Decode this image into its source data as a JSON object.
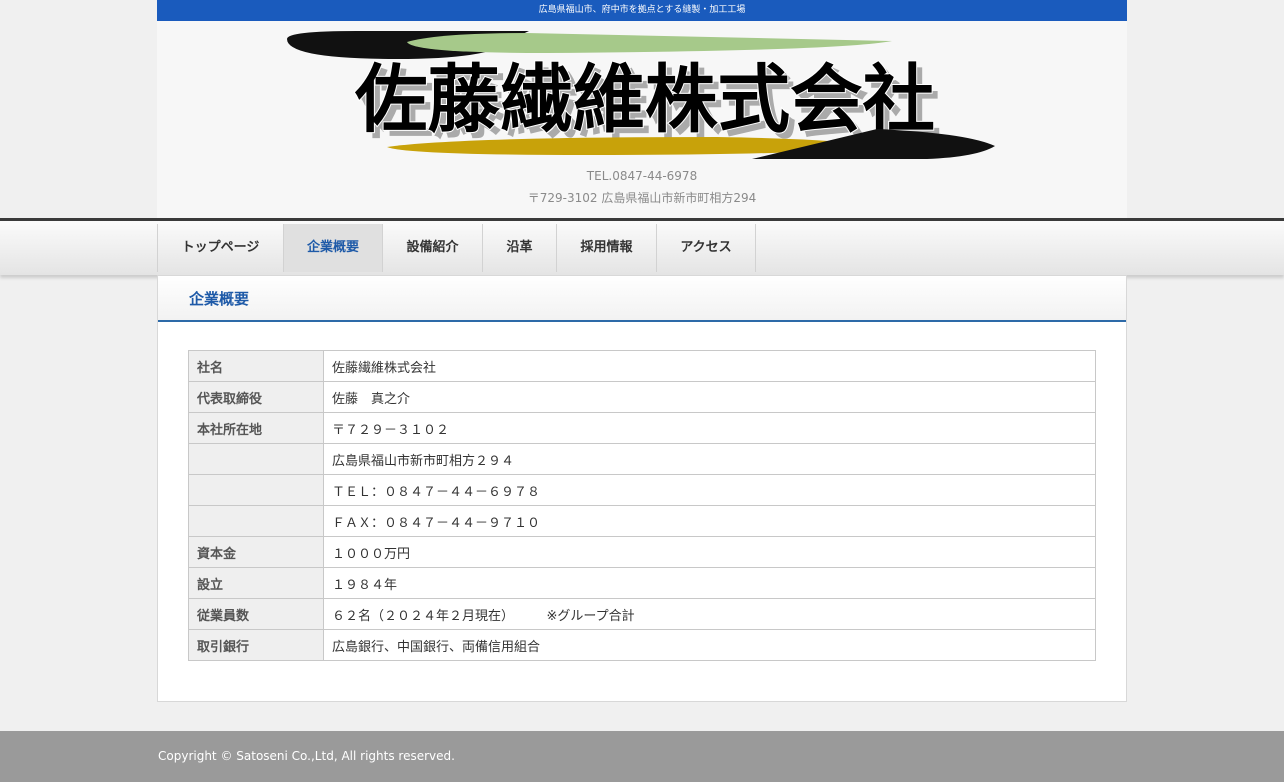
{
  "header": {
    "tagline": "広島県福山市、府中市を拠点とする縫製・加工工場",
    "logo_text": "佐藤繊維株式会社",
    "tel": "TEL.0847-44-6978",
    "address": "〒729-3102 広島県福山市新市町相方294"
  },
  "nav": {
    "items": [
      {
        "label": "トップページ"
      },
      {
        "label": "企業概要"
      },
      {
        "label": "設備紹介"
      },
      {
        "label": "沿革"
      },
      {
        "label": "採用情報"
      },
      {
        "label": "アクセス"
      }
    ],
    "active": "企業概要"
  },
  "main": {
    "title": "企業概要",
    "rows": [
      {
        "label": "社名",
        "value": "佐藤繊維株式会社"
      },
      {
        "label": "代表取締役",
        "value": "佐藤　真之介"
      },
      {
        "label": "本社所在地",
        "value": "〒７２９－３１０２"
      },
      {
        "label": "",
        "value": "広島県福山市新市町相方２９４"
      },
      {
        "label": "",
        "value": "ＴＥＬ：０８４７－４４－６９７８"
      },
      {
        "label": "",
        "value": "ＦＡＸ：０８４７－４４－９７１０"
      },
      {
        "label": "資本金",
        "value": "１０００万円"
      },
      {
        "label": "設立",
        "value": "１９８４年"
      },
      {
        "label": "従業員数",
        "value": "６２名（２０２４年２月現在）　　　※グループ合計"
      },
      {
        "label": "取引銀行",
        "value": "広島銀行、中国銀行、両備信用組合"
      }
    ]
  },
  "footer": {
    "copyright": "Copyright © Satoseni Co.,Ltd, All rights reserved."
  },
  "colors": {
    "topbar": "#1a5bbd",
    "accent": "#1e5aa8",
    "logo_green": "#a6c98a",
    "logo_gold": "#c8a20a",
    "footer": "#9a9a9a"
  }
}
